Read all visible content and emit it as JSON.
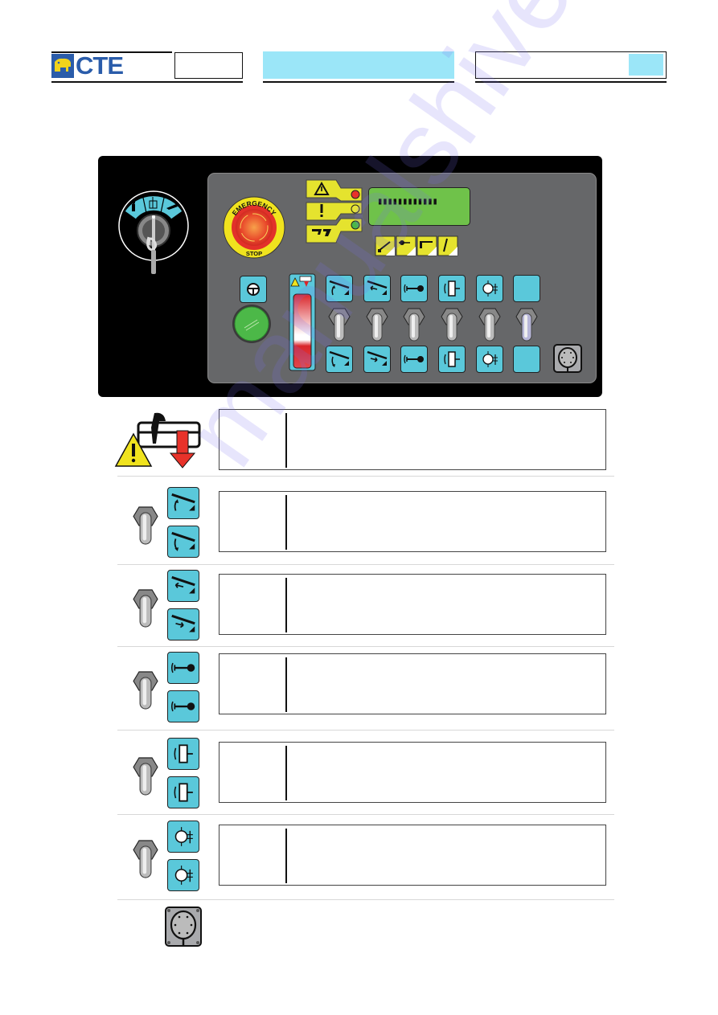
{
  "header": {
    "logo_text": "CTE",
    "page_box_left": "",
    "section_title": "",
    "page_box_right": "",
    "page_number": ""
  },
  "panel": {
    "key_switch": {
      "positions": [
        "ground-control-icon",
        "basket-control-icon",
        "truck-control-icon"
      ]
    },
    "emergency_stop": {
      "top_label": "EMERGENCY",
      "bottom_label": "STOP"
    },
    "warning_lights": [
      {
        "icon": "warning-triangle-icon",
        "led_color": "#e8322a"
      },
      {
        "icon": "exclamation-icon",
        "led_color": "#e6e33a"
      },
      {
        "icon": "outrigger-icon",
        "led_color": "#4cb848"
      }
    ],
    "lcd": {
      "text": "▮▮▮▮▮▮▮▮▮▮▮▮"
    },
    "mode_buttons": [
      "boom-lift-mode-icon",
      "telescope-mode-icon",
      "jib-mode-icon",
      "basket-level-mode-icon"
    ],
    "horn_button": "steering-wheel-icon",
    "start_button": "green-start-button",
    "descent_indicator": "basket-descent-warning-icon",
    "controls": [
      {
        "name": "boom-lift",
        "up": "boom-raise-icon",
        "down": "boom-lower-icon"
      },
      {
        "name": "boom-extend",
        "up": "boom-extend-icon",
        "down": "boom-retract-icon"
      },
      {
        "name": "jib",
        "up": "jib-up-icon",
        "down": "jib-down-icon"
      },
      {
        "name": "basket-rotation",
        "up": "basket-rotate-left-icon",
        "down": "basket-rotate-right-icon"
      },
      {
        "name": "turret-rotation",
        "up": "turret-rotate-cw-icon",
        "down": "turret-rotate-ccw-icon"
      },
      {
        "name": "spare",
        "up": "",
        "down": ""
      }
    ],
    "socket": "connector-socket-icon"
  },
  "legend": [
    {
      "icon": "basket-descent-warning-icon",
      "col1": "",
      "col2": ""
    },
    {
      "icon": "boom-lift-toggle",
      "col1": "",
      "col2": ""
    },
    {
      "icon": "boom-extend-toggle",
      "col1": "",
      "col2": ""
    },
    {
      "icon": "jib-toggle",
      "col1": "",
      "col2": ""
    },
    {
      "icon": "basket-rotation-toggle",
      "col1": "",
      "col2": ""
    },
    {
      "icon": "turret-rotation-toggle",
      "col1": "",
      "col2": ""
    }
  ],
  "watermark": "manualshive.com"
}
